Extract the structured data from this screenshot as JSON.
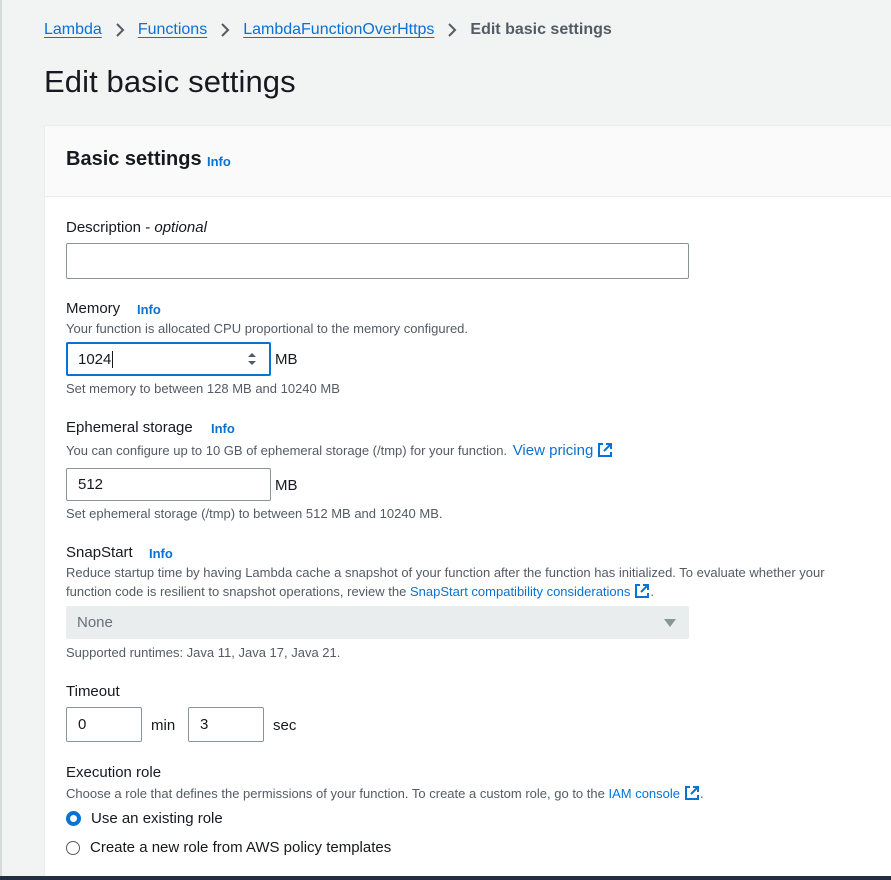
{
  "breadcrumb": {
    "items": [
      "Lambda",
      "Functions",
      "LambdaFunctionOverHttps"
    ],
    "current": "Edit basic settings"
  },
  "page_title": "Edit basic settings",
  "panel": {
    "title": "Basic settings",
    "info": "Info"
  },
  "description": {
    "label": "Description - ",
    "label_optional": "optional",
    "value": ""
  },
  "memory": {
    "label": "Memory",
    "info": "Info",
    "description": "Your function is allocated CPU proportional to the memory configured.",
    "value": "1024",
    "unit": "MB",
    "hint": "Set memory to between 128 MB and 10240 MB"
  },
  "ephemeral": {
    "label": "Ephemeral storage",
    "info": "Info",
    "description": "You can configure up to 10 GB of ephemeral storage (/tmp) for your function.",
    "pricing_link": "View pricing",
    "value": "512",
    "unit": "MB",
    "hint": "Set ephemeral storage (/tmp) to between 512 MB and 10240 MB."
  },
  "snapstart": {
    "label": "SnapStart",
    "info": "Info",
    "description_1": "Reduce startup time by having Lambda cache a snapshot of your function after the function has initialized. To evaluate whether your",
    "description_2": "function code is resilient to snapshot operations, review the",
    "link": "SnapStart compatibility considerations",
    "period": ".",
    "selected": "None",
    "hint": "Supported runtimes: Java 11, Java 17, Java 21."
  },
  "timeout": {
    "label": "Timeout",
    "min_value": "0",
    "min_unit": "min",
    "sec_value": "3",
    "sec_unit": "sec"
  },
  "execution_role": {
    "label": "Execution role",
    "description": "Choose a role that defines the permissions of your function. To create a custom role, go to the",
    "iam_link": "IAM console",
    "period": ".",
    "options": [
      "Use an existing role",
      "Create a new role from AWS policy templates"
    ],
    "selected_index": 0
  },
  "colors": {
    "link": "#0972d3",
    "background": "#f2f3f3",
    "panel": "#ffffff",
    "disabled": "#eaeded"
  },
  "icons": {
    "breadcrumb_separator": "chevron-right-icon",
    "external": "external-link-icon",
    "spinner": "spinner-arrows-icon",
    "select": "caret-down-icon"
  }
}
